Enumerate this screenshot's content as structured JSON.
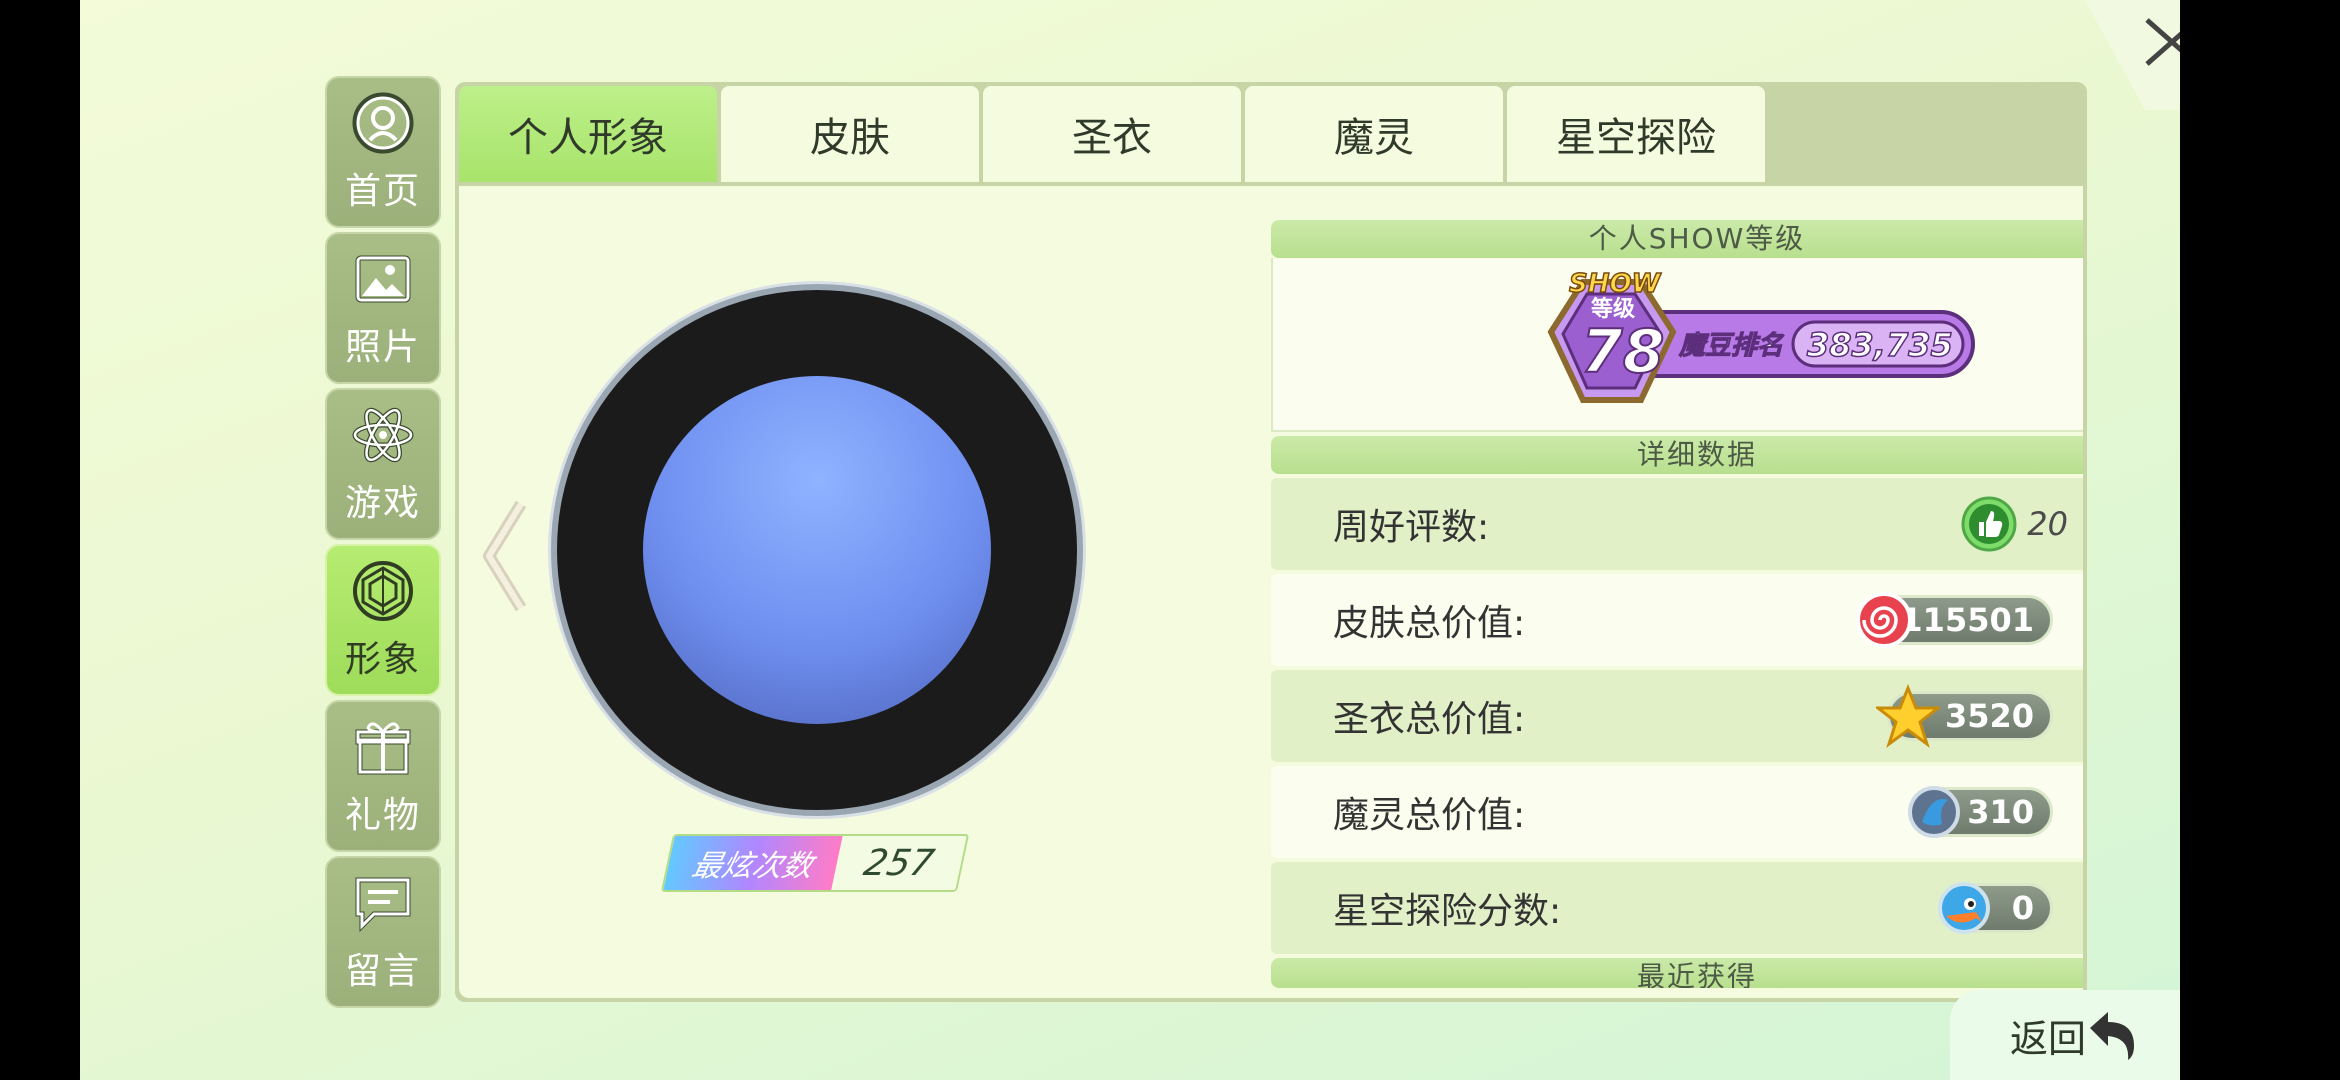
{
  "sidebar": {
    "items": [
      {
        "label": "首页",
        "icon": "user-circle-icon",
        "active": false
      },
      {
        "label": "照片",
        "icon": "photo-icon",
        "active": false
      },
      {
        "label": "游戏",
        "icon": "atom-icon",
        "active": false
      },
      {
        "label": "形象",
        "icon": "gem-icon",
        "active": true
      },
      {
        "label": "礼物",
        "icon": "gift-icon",
        "active": false
      },
      {
        "label": "留言",
        "icon": "message-icon",
        "active": false
      }
    ]
  },
  "tabs": [
    {
      "label": "个人形象",
      "active": true
    },
    {
      "label": "皮肤",
      "active": false
    },
    {
      "label": "圣衣",
      "active": false
    },
    {
      "label": "魔灵",
      "active": false
    },
    {
      "label": "星空探险",
      "active": false
    }
  ],
  "avatar": {
    "badge_label": "最炫次数",
    "badge_value": "257"
  },
  "show_level": {
    "header": "个人SHOW等级",
    "show_text": "SHOW",
    "level_text": "等级",
    "level": "78",
    "rank_label": "魔豆排名",
    "rank_value": "383,735"
  },
  "details": {
    "header": "详细数据",
    "rows": [
      {
        "label": "周好评数:",
        "value": "20",
        "icon": "thumbs-up-icon"
      },
      {
        "label": "皮肤总价值:",
        "value": "115501",
        "icon": "swirl-candy-icon"
      },
      {
        "label": "圣衣总价值:",
        "value": "3520",
        "icon": "star-icon"
      },
      {
        "label": "魔灵总价值:",
        "value": "310",
        "icon": "spirit-orb-icon"
      },
      {
        "label": "星空探险分数:",
        "value": "0",
        "icon": "bird-icon"
      }
    ]
  },
  "recent": {
    "header": "最近获得"
  },
  "back": {
    "label": "返回"
  },
  "colors": {
    "active_tab": "#a8e46b",
    "sidebar_default": "#a9bd86",
    "sidebar_active": "#9fdc5a",
    "panel_bg": "#f5fbdf"
  }
}
